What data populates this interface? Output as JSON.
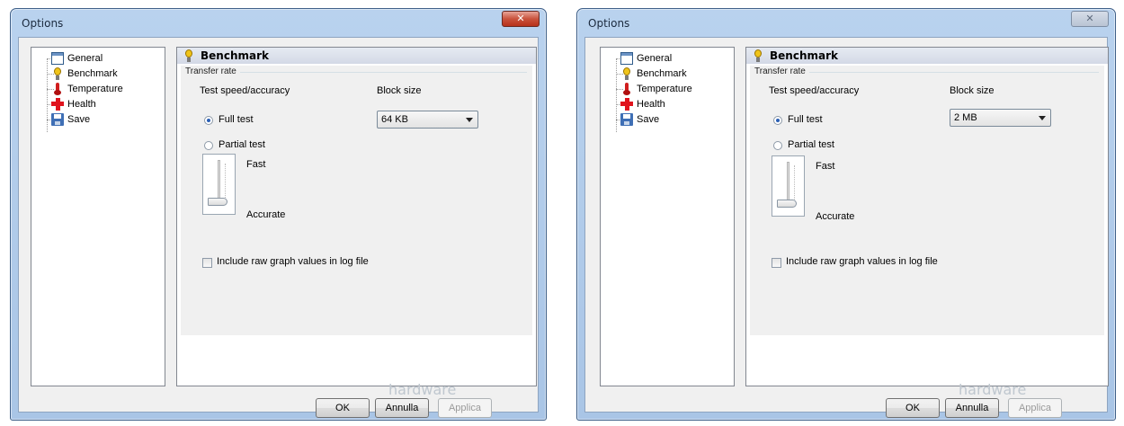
{
  "windows": [
    {
      "title": "Options",
      "close_glyph": "✕",
      "tree": [
        "General",
        "Benchmark",
        "Temperature",
        "Health",
        "Save"
      ],
      "panel_title": "Benchmark",
      "group_label": "Transfer rate",
      "speed_label": "Test speed/accuracy",
      "block_label": "Block size",
      "full_test": "Full test",
      "partial_test": "Partial test",
      "block_value": "64 KB",
      "slider_fast": "Fast",
      "slider_accurate": "Accurate",
      "log_checkbox_label": "Include raw graph values in log file",
      "buttons": {
        "ok": "OK",
        "cancel": "Annulla",
        "apply": "Applica"
      },
      "watermark": "hardware"
    },
    {
      "title": "Options",
      "close_glyph": "✕",
      "tree": [
        "General",
        "Benchmark",
        "Temperature",
        "Health",
        "Save"
      ],
      "panel_title": "Benchmark",
      "group_label": "Transfer rate",
      "speed_label": "Test speed/accuracy",
      "block_label": "Block size",
      "full_test": "Full test",
      "partial_test": "Partial test",
      "block_value": "2 MB",
      "slider_fast": "Fast",
      "slider_accurate": "Accurate",
      "log_checkbox_label": "Include raw graph values in log file",
      "buttons": {
        "ok": "OK",
        "cancel": "Annulla",
        "apply": "Applica"
      },
      "watermark": "hardware"
    }
  ],
  "icons": {
    "general": "window-icon",
    "benchmark": "lightbulb-icon",
    "temperature": "thermometer-icon",
    "health": "red-cross-icon",
    "save": "floppy-disk-icon"
  },
  "state": {
    "left_selected_option": "Full test",
    "right_selected_option": "Full test",
    "slider_level": "Accurate",
    "log_checkbox_checked": false,
    "apply_enabled": false
  }
}
